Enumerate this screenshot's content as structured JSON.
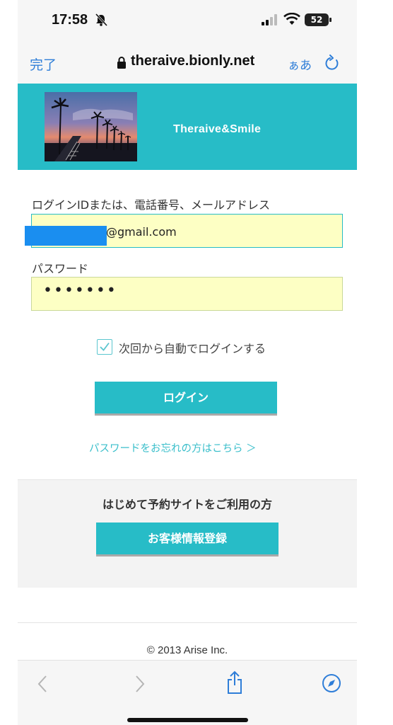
{
  "status_bar": {
    "time": "17:58",
    "battery": "52"
  },
  "browser": {
    "done_label": "完了",
    "url": "theraive.bionly.net",
    "text_size_label": "ぁあ"
  },
  "header": {
    "brand": "Theraive&Smile"
  },
  "login_form": {
    "id_label": "ログインIDまたは、電話番号、メールアドレス",
    "id_value": "@gmail.com",
    "password_label": "パスワード",
    "password_value": "•••••••",
    "remember_label": "次回から自動でログインする",
    "remember_checked": true,
    "login_button": "ログイン",
    "forgot_link": "パスワードをお忘れの方はこちら ＞"
  },
  "new_user": {
    "title": "はじめて予約サイトをご利用の方",
    "register_button": "お客様情報登録"
  },
  "footer": {
    "copyright": "© 2013 Arise Inc."
  },
  "colors": {
    "accent": "#27bcc7",
    "link": "#2f7ed8",
    "field_bg": "#fdffc4"
  }
}
